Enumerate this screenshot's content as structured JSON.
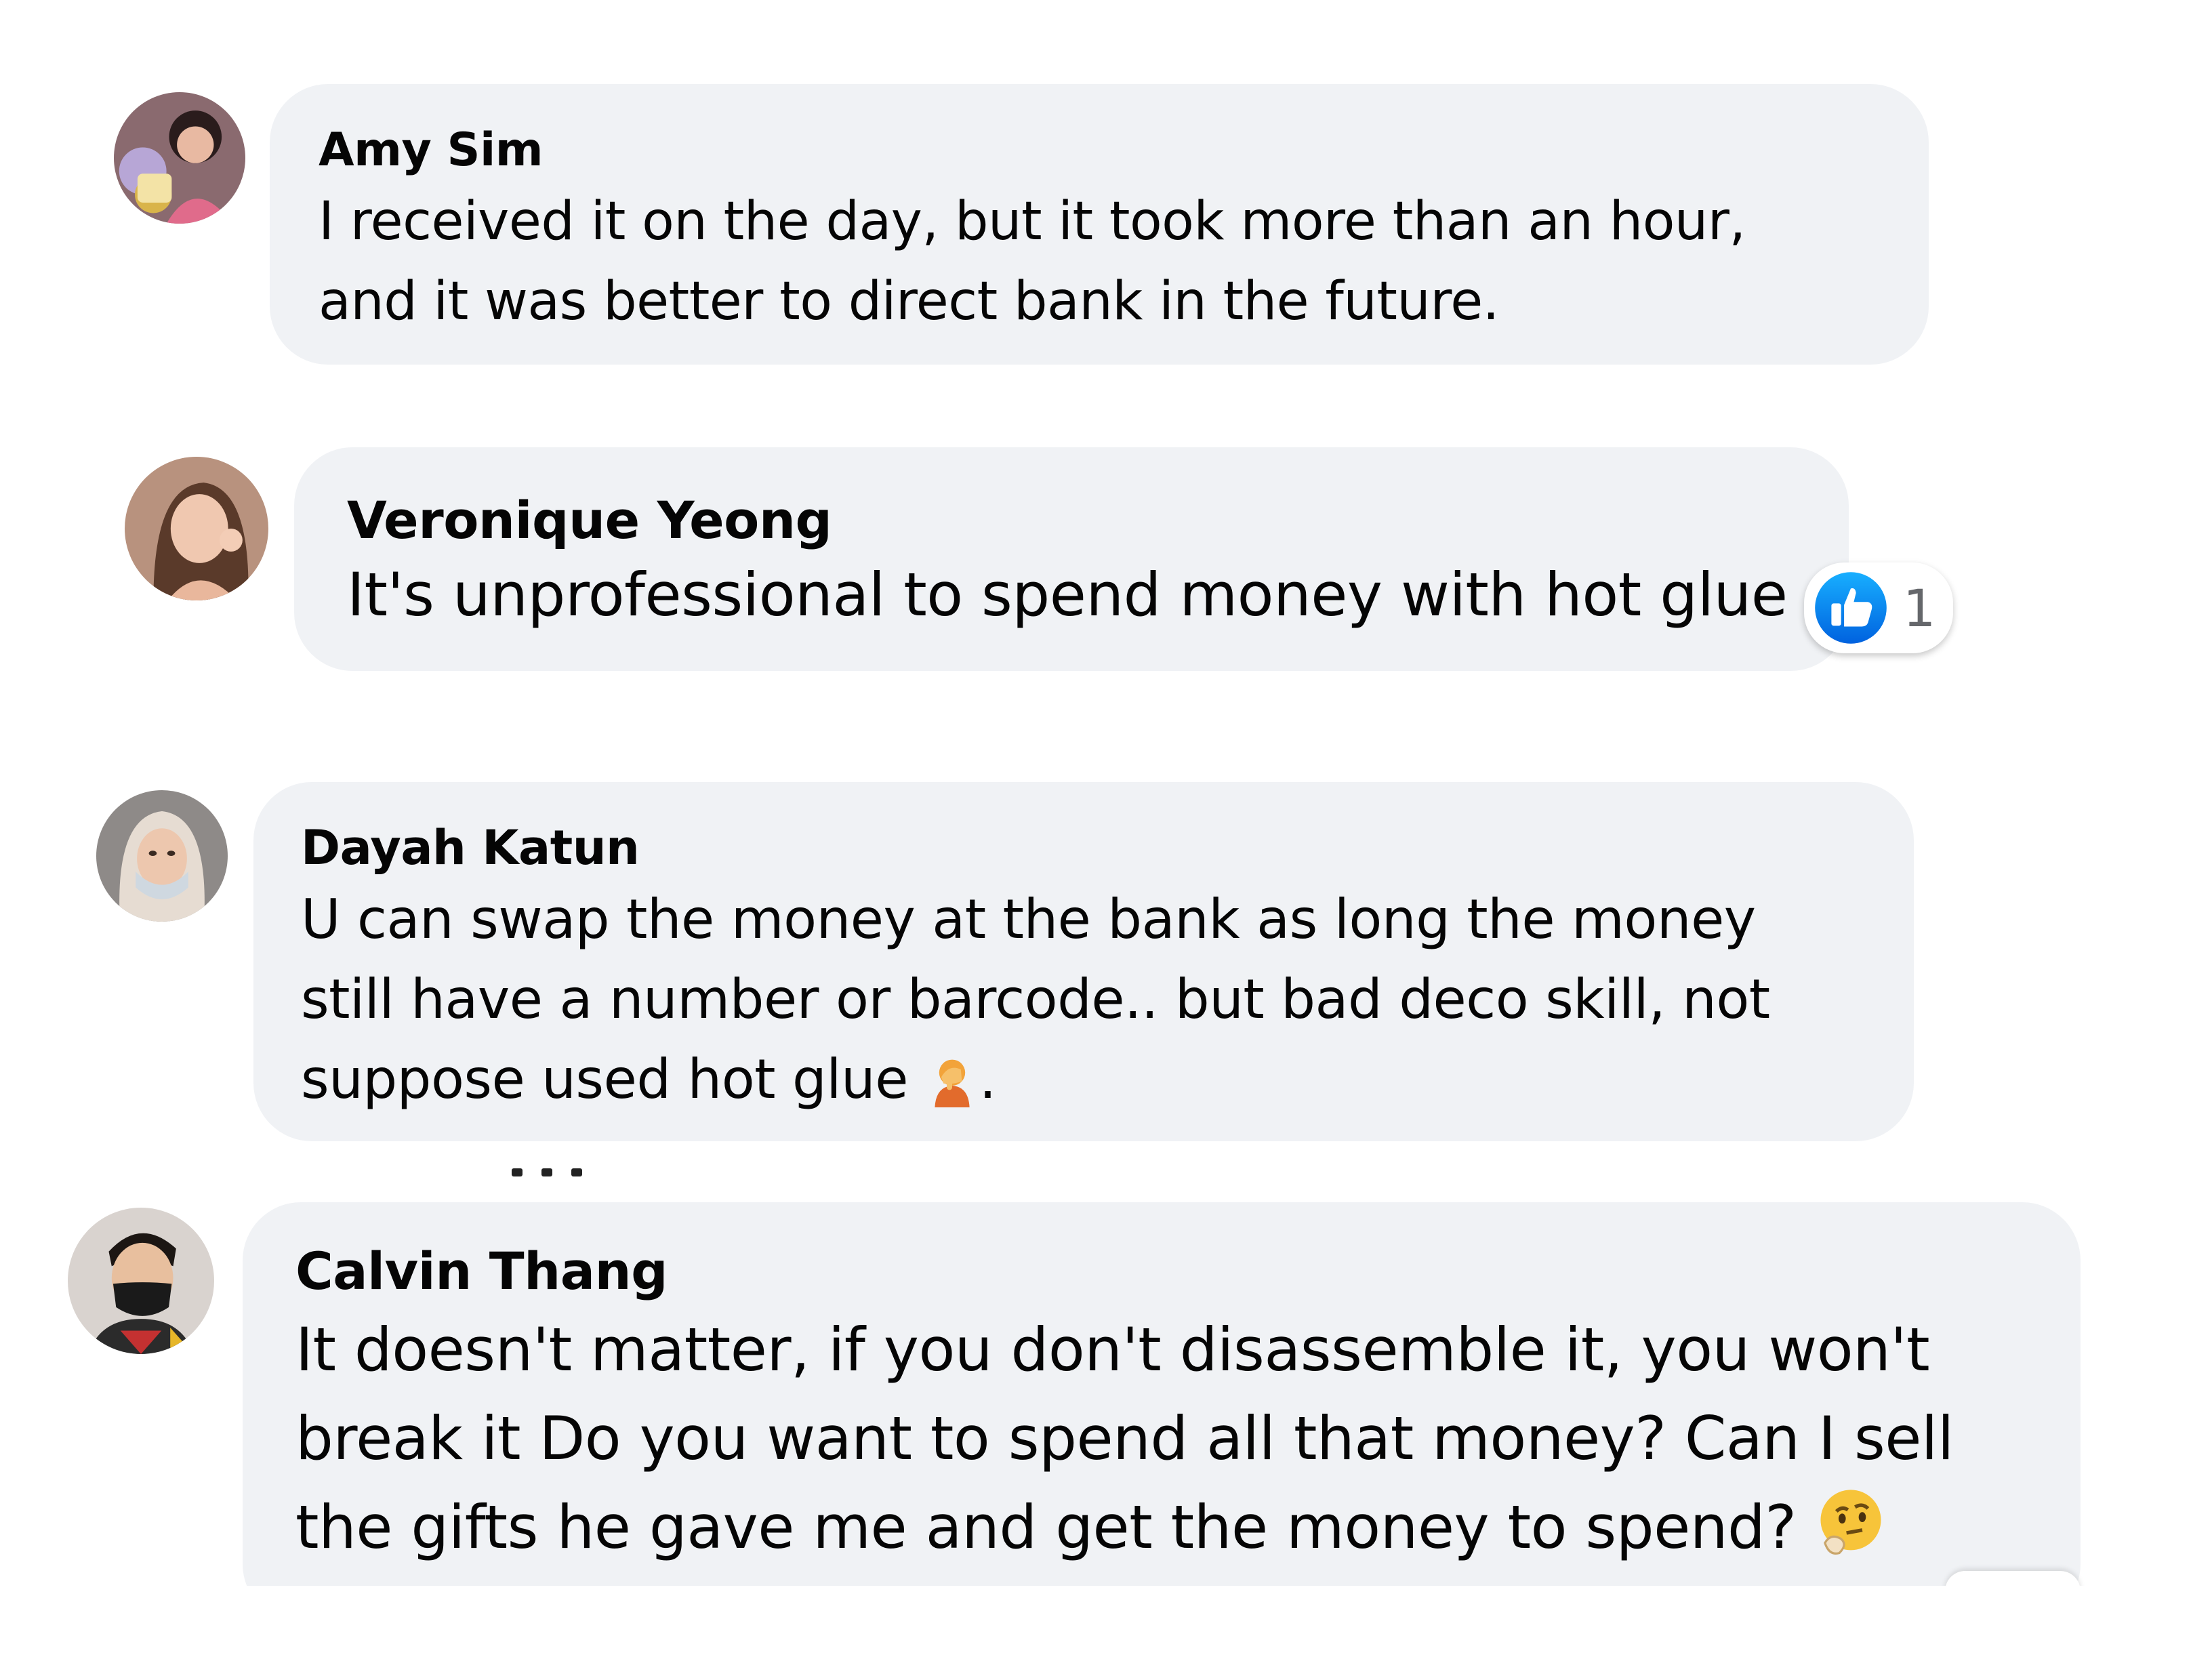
{
  "comments": [
    {
      "author": "Amy Sim",
      "text": "I received it on the day, but it took more than an hour,\nand it was better to direct bank in the future."
    },
    {
      "author": "Veronique Yeong",
      "text": "It's unprofessional to spend money with hot glue",
      "reaction": {
        "type": "like",
        "icon": "thumbs-up-icon",
        "count": "1"
      }
    },
    {
      "author": "Dayah Katun",
      "text": "U can swap the money at the bank as long the money\nstill have a number or barcode.. but bad deco skill, not\nsuppose used hot glue ",
      "emoji": "facepalm-emoji",
      "trailing": "."
    },
    {
      "author": "Calvin Thang",
      "text": "It doesn't matter, if you don't disassemble it, you won't\nbreak it Do you want to spend all that money? Can I sell\nthe gifts he gave me and get the money to spend? ",
      "emoji": "thinking-face-emoji"
    }
  ],
  "colors": {
    "bubble": "#f0f2f5",
    "text": "#050505",
    "like_blue": "#1877f2",
    "count_gray": "#65676b"
  }
}
